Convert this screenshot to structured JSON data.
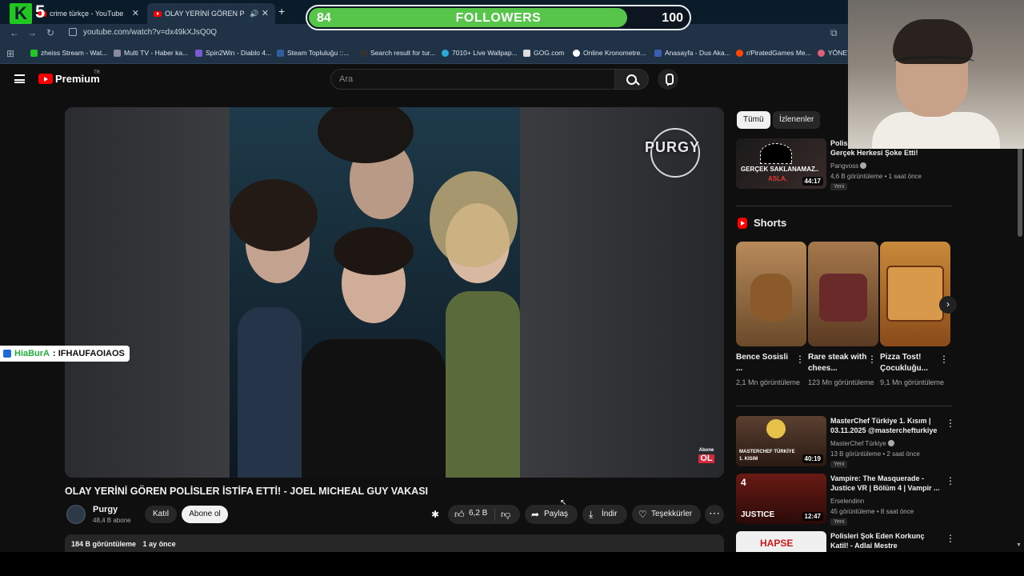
{
  "browser": {
    "tabs": [
      {
        "title": "crime türkçe - YouTube",
        "active": false
      },
      {
        "title": "OLAY YERİNİ GÖREN POLİS",
        "active": true
      }
    ],
    "url": "youtube.com/watch?v=dx49kXJsQ0Q",
    "bookmarks": [
      {
        "label": "zheiss Stream - Wat..."
      },
      {
        "label": "Multi TV - Haber ka..."
      },
      {
        "label": "Spin2Win - Diablo 4..."
      },
      {
        "label": "Steam Topluluğu ::..."
      },
      {
        "label": "Search result for tur..."
      },
      {
        "label": "7010+ Live Wallpap..."
      },
      {
        "label": "GOG.com"
      },
      {
        "label": "Online Kronometre..."
      },
      {
        "label": "Anasayfa - Dus Aka..."
      },
      {
        "label": "r/PiratedGames Me..."
      },
      {
        "label": "YÖNET"
      }
    ]
  },
  "overlay": {
    "kick_num": "5",
    "followers_current": "84",
    "followers_label": "FOLLOWERS",
    "followers_goal": "100",
    "followers_fraction": 0.84,
    "chat_user": "HiaBurA",
    "chat_message": ": IFHAUFAOIAOS"
  },
  "youtube": {
    "brand": "Premium",
    "region": "TR",
    "search_placeholder": "Ara"
  },
  "video": {
    "title": "OLAY YERİNİ GÖREN POLİSLER İSTİFA ETTİ! - JOEL MICHEAL GUY VAKASI",
    "watermark": "PURGY",
    "overlay_badge_1": "Abone",
    "overlay_badge_2": "OL",
    "channel": {
      "name": "Purgy",
      "subs": "48,4 B abone"
    },
    "join_label": "Katıl",
    "subscribe_label": "Abone ol",
    "likes": "6,2 B",
    "share_label": "Paylaş",
    "download_label": "İndir",
    "thanks_label": "Teşekkürler",
    "views": "184 B görüntüleme",
    "age": "1 ay önce"
  },
  "sidebar": {
    "chips": [
      "Tümü",
      "İzlenenler"
    ],
    "top_video": {
      "title_line1": "Polisi",
      "title_line2": "Gerçek Herkesi Şoke Etti!",
      "channel": "Pangvoss",
      "meta": "4,6 B görüntüleme • 1 saat önce",
      "badge": "Yeni",
      "duration": "44:17",
      "thumb_text": "GERÇEK SAKLANAMAZ..",
      "thumb_text2": "ASLA."
    },
    "shorts_header": "Shorts",
    "shorts": [
      {
        "title": "Bence Sosisli ...",
        "views": "2,1 Mn görüntüleme"
      },
      {
        "title": "Rare steak with chees...",
        "views": "123 Mn görüntüleme"
      },
      {
        "title": "Pizza Tost! Çocukluğu...",
        "views": "9,1 Mn görüntüleme"
      }
    ],
    "videos": [
      {
        "title": "MasterChef Türkiye 1. Kısım | 03.11.2025 @masterchefturkiye",
        "channel": "MasterChef Türkiye",
        "meta": "13 B görüntüleme • 2 saat önce",
        "badge": "Yeni",
        "duration": "40:19",
        "thumb_text": "MASTERCHEF TÜRKİYE",
        "thumb_text2": "1. KISIM"
      },
      {
        "title": "Vampire: The Masquerade - Justice VR | Bölüm 4 | Vampir ...",
        "channel": "Erselendinn",
        "meta": "45 görüntüleme • 8 saat önce",
        "badge": "Yeni",
        "duration": "12:47",
        "thumb_text": "4",
        "thumb_text2": "JUSTICE"
      },
      {
        "title": "Polisleri Şok Eden Korkunç Katil! - Adlai Mestre",
        "channel": "",
        "meta": "",
        "badge": "",
        "duration": "",
        "thumb_text": "HAPSE",
        "thumb_text2": ""
      }
    ]
  },
  "colors": {
    "background": "#0f0f0f",
    "youtube_red": "#ff0000",
    "followers_fill": "#57c54a",
    "kick_green": "#22c622"
  }
}
